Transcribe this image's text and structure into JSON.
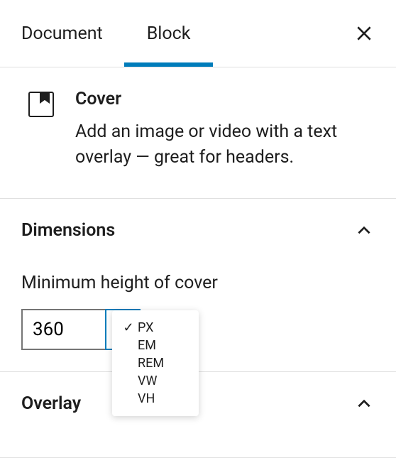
{
  "tabs": {
    "document": "Document",
    "block": "Block"
  },
  "block": {
    "name": "Cover",
    "description": "Add an image or video with a text overlay — great for headers."
  },
  "panels": {
    "dimensions": {
      "title": "Dimensions",
      "min_height_label": "Minimum height of cover",
      "min_height_value": "360",
      "unit_button": "PX"
    },
    "overlay": {
      "title": "Overlay"
    }
  },
  "unit_options": [
    {
      "label": "PX",
      "selected": true
    },
    {
      "label": "EM",
      "selected": false
    },
    {
      "label": "REM",
      "selected": false
    },
    {
      "label": "VW",
      "selected": false
    },
    {
      "label": "VH",
      "selected": false
    }
  ]
}
